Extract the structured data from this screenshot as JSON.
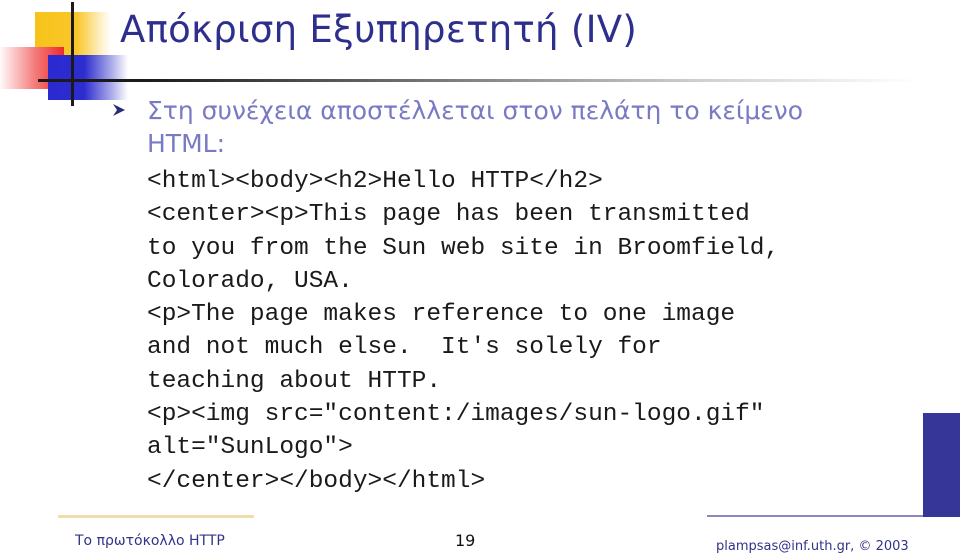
{
  "slide": {
    "title": "Απόκριση Εξυπηρετητή (IV)",
    "bullet": {
      "icon": "arrowhead-bullet-icon",
      "text": "Στη συνέχεια αποστέλλεται στον πελάτη το κείμενο HTML:"
    },
    "code_lines": [
      "<html><body><h2>Hello HTTP</h2>",
      "<center><p>This page has been transmitted",
      "to you from the Sun web site in Broomfield,",
      "Colorado, USA.",
      "<p>The page makes reference to one image",
      "and not much else.  It's solely for",
      "teaching about HTTP.",
      "<p><img src=\"content:/images/sun-logo.gif\"",
      "alt=\"SunLogo\">",
      "</center></body></html>"
    ]
  },
  "footer": {
    "title": "Το πρωτόκολλο HTTP",
    "page_number": "19",
    "credit": "plampsas@inf.uth.gr,  © 2003"
  },
  "colors": {
    "title": "#2e2e8c",
    "bullet_text": "#7a7ac4",
    "accent_blue": "#363699",
    "accent_yellow": "#f7c31a",
    "accent_red": "#ee2a2a"
  }
}
